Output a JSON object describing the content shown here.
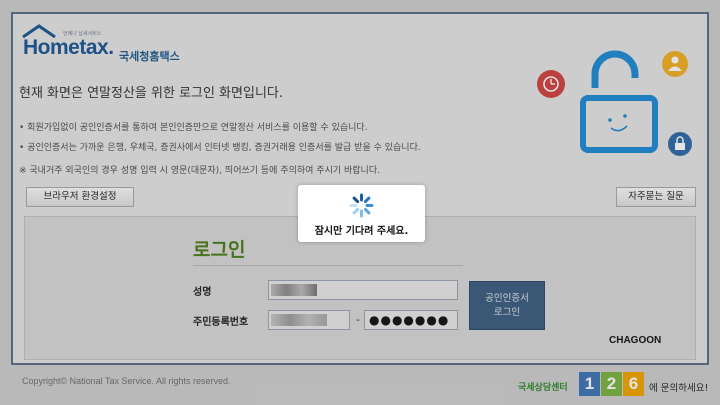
{
  "header": {
    "logo_text": "Hometax.",
    "logo_slogan": "언제나 납세서비스",
    "agency_name": "국세청홈택스"
  },
  "main": {
    "headline": "현재 화면은 연말정산을 위한 로그인 화면입니다.",
    "notices": [
      "• 회원가입없이 공인인증서를 통하여 본인인증만으로 연말정산 서비스를 이용할 수 있습니다.",
      "• 공인인증서는 가까운 은행, 우체국, 증권사에서 인터넷 뱅킹, 증권거래용 인증서를 발급 받을 수 있습니다.",
      "※ 국내거주 외국인의 경우 성명 입력 시 영문(대문자), 띄어쓰기 등에 주의하여 주시기 바랍니다."
    ],
    "browser_settings_label": "브라우저 환경설정",
    "faq_label": "자주묻는 질문"
  },
  "login": {
    "title": "로그인",
    "name_label": "성명",
    "rrn_label": "주민등록번호",
    "rrn_dash": "-",
    "rrn_back_value": "●●●●●●●",
    "cert_button_line1": "공인인증서",
    "cert_button_line2": "로그인",
    "watermark": "CHAGOON"
  },
  "footer": {
    "copyright": "Copyright© National Tax Service. All rights reserved.",
    "call_center_name": "국세상담센터",
    "call_center_digits": [
      "1",
      "2",
      "6"
    ],
    "call_center_tail": "에 문의하세요!"
  },
  "loading": {
    "message": "잠시만 기다려 주세요."
  },
  "colors": {
    "frame": "#5d6d85",
    "login_green": "#4c7c1b",
    "cert_button": "#3b5d80",
    "lock_blue": "#1e8ad6"
  }
}
